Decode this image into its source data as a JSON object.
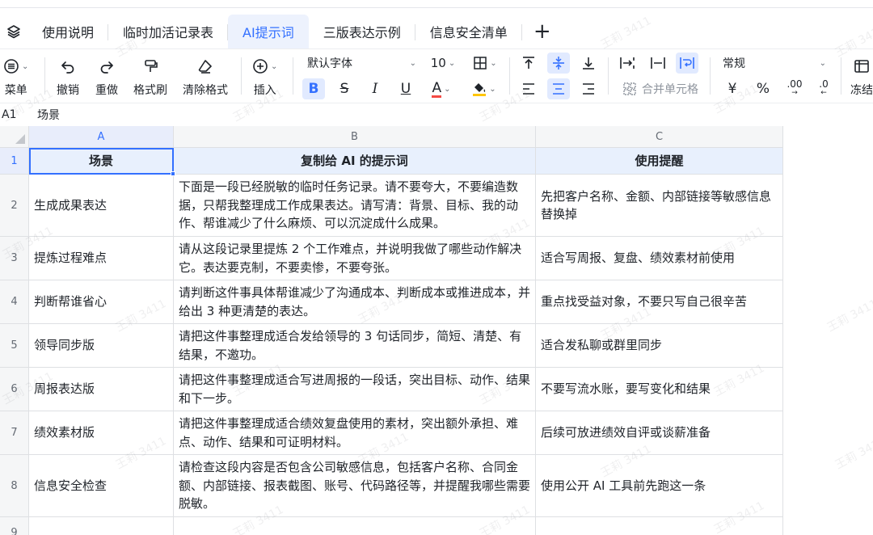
{
  "tabs": [
    {
      "label": "使用说明",
      "active": false
    },
    {
      "label": "临时加活记录表",
      "active": false
    },
    {
      "label": "AI提示词",
      "active": true
    },
    {
      "label": "三版表达示例",
      "active": false
    },
    {
      "label": "信息安全清单",
      "active": false
    }
  ],
  "tab_add_symbol": "+",
  "toolbar": {
    "menu": "菜单",
    "undo": "撤销",
    "redo": "重做",
    "format_painter": "格式刷",
    "clear_format": "清除格式",
    "insert": "插入",
    "font_family": "默认字体",
    "font_size": "10",
    "bold": "B",
    "strike": "S",
    "italic": "I",
    "underline": "U",
    "font_color": "A",
    "merge_cells": "合并单元格",
    "number_format": "常规",
    "currency": "¥",
    "percent": "%",
    "dec_inc": ".00",
    "dec_dec": ".0",
    "freeze": "冻结"
  },
  "formula_bar": {
    "cell_ref": "A1",
    "value": "场景"
  },
  "columns": [
    "A",
    "B",
    "C"
  ],
  "rows": [
    {
      "num": "1",
      "cells": [
        "场景",
        "复制给 AI 的提示词",
        "使用提醒"
      ]
    },
    {
      "num": "2",
      "cells": [
        "生成成果表达",
        "下面是一段已经脱敏的临时任务记录。请不要夸大，不要编造数据，只帮我整理成工作成果表达。请写清：背景、目标、我的动作、帮谁减少了什么麻烦、可以沉淀成什么成果。",
        "先把客户名称、金额、内部链接等敏感信息替换掉"
      ]
    },
    {
      "num": "3",
      "cells": [
        "提炼过程难点",
        "请从这段记录里提炼 2 个工作难点，并说明我做了哪些动作解决它。表达要克制，不要卖惨，不要夸张。",
        "适合写周报、复盘、绩效素材前使用"
      ]
    },
    {
      "num": "4",
      "cells": [
        "判断帮谁省心",
        "请判断这件事具体帮谁减少了沟通成本、判断成本或推进成本，并给出 3 种更清楚的表达。",
        "重点找受益对象，不要只写自己很辛苦"
      ]
    },
    {
      "num": "5",
      "cells": [
        "领导同步版",
        "请把这件事整理成适合发给领导的 3 句话同步，简短、清楚、有结果，不邀功。",
        "适合发私聊或群里同步"
      ]
    },
    {
      "num": "6",
      "cells": [
        "周报表达版",
        "请把这件事整理成适合写进周报的一段话，突出目标、动作、结果和下一步。",
        "不要写流水账，要写变化和结果"
      ]
    },
    {
      "num": "7",
      "cells": [
        "绩效素材版",
        "请把这件事整理成适合绩效复盘使用的素材，突出额外承担、难点、动作、结果和可证明材料。",
        "后续可放进绩效自评或谈薪准备"
      ]
    },
    {
      "num": "8",
      "cells": [
        "信息安全检查",
        "请检查这段内容是否包含公司敏感信息，包括客户名称、合同金额、内部链接、报表截图、账号、代码路径等，并提醒我哪些需要脱敏。",
        "使用公开 AI 工具前先跑这一条"
      ]
    },
    {
      "num": "9",
      "cells": [
        "",
        "",
        ""
      ]
    }
  ],
  "watermark": "王莉 3411"
}
